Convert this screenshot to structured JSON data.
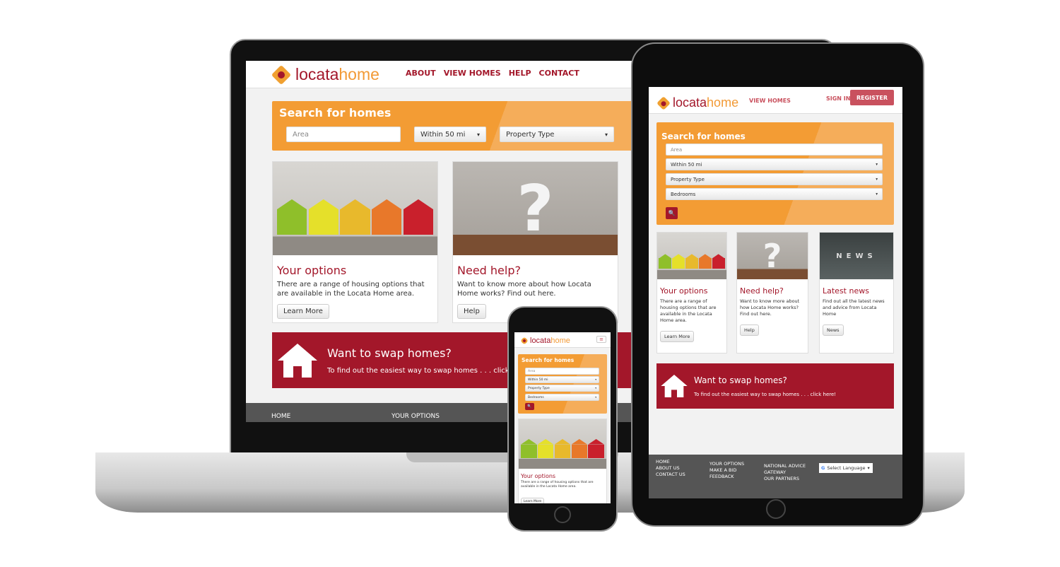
{
  "brand": {
    "logo_part1": "locata",
    "logo_part2": "home",
    "primary": "#a3172a",
    "accent": "#f39c34"
  },
  "laptop": {
    "nav": [
      "ABOUT",
      "VIEW HOMES",
      "HELP",
      "CONTACT"
    ],
    "search": {
      "title": "Search for homes",
      "area_placeholder": "Area",
      "distance": "Within 50 mi",
      "property_type": "Property Type"
    },
    "cards": [
      {
        "title": "Your options",
        "text": "There are a range of housing options that are available in the Locata Home area.",
        "button": "Learn More"
      },
      {
        "title": "Need help?",
        "text": "Want to know more about how Locata Home works? Find out here.",
        "button": "Help"
      }
    ],
    "banner": {
      "title": "Want to swap homes?",
      "text": "To find out the easiest way to swap homes . . . click here!"
    },
    "footer": [
      "HOME",
      "YOUR OPTIONS"
    ]
  },
  "tablet": {
    "nav": {
      "view_homes": "VIEW HOMES",
      "sign_in": "SIGN IN",
      "register": "REGISTER"
    },
    "search": {
      "title": "Search for homes",
      "area_placeholder": "Area",
      "distance": "Within 50 mi",
      "property_type": "Property Type",
      "bedrooms": "Bedrooms",
      "search_icon": "search-icon"
    },
    "cards": [
      {
        "title": "Your options",
        "text": "There are a range of housing options that are available in the Locata Home area.",
        "button": "Learn More"
      },
      {
        "title": "Need help?",
        "text": "Want to know more about how Locata Home works? Find out here.",
        "button": "Help"
      },
      {
        "title": "Latest news",
        "text": "Find out all the latest news and advice from Locata Home",
        "button": "News",
        "image_text": "NEWS"
      }
    ],
    "banner": {
      "title": "Want to swap homes?",
      "text": "To find out the easiest way to swap homes . . . click here!"
    },
    "footer": {
      "col1": [
        "HOME",
        "ABOUT US",
        "CONTACT US"
      ],
      "col2": [
        "YOUR OPTIONS",
        "MAKE A BID",
        "FEEDBACK"
      ],
      "col3": [
        "NATIONAL ADVICE",
        "GATEWAY",
        "OUR PARTNERS"
      ],
      "language": "Select Language"
    }
  },
  "phone": {
    "search": {
      "title": "Search for homes",
      "area_placeholder": "Area",
      "distance": "Within 50 mi",
      "property_type": "Property Type",
      "bedrooms": "Bedrooms"
    },
    "card": {
      "title": "Your options",
      "text": "There are a range of housing options that are available in the Locata Home area.",
      "button": "Learn More"
    }
  }
}
